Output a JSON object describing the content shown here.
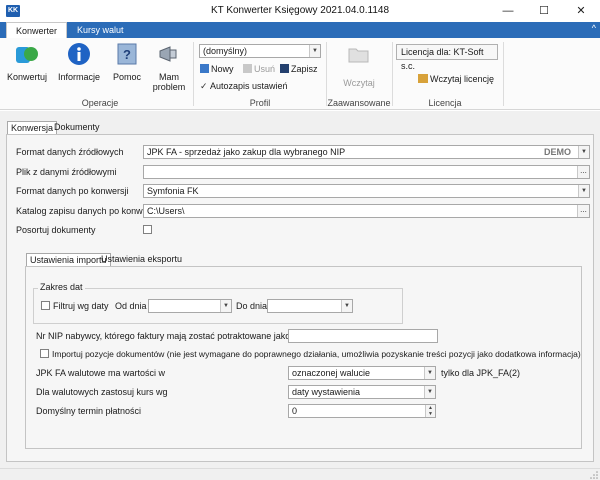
{
  "window": {
    "app_icon_label": "KK",
    "title": "KT Konwerter Księgowy 2021.04.0.1148",
    "minimize": "—",
    "maximize": "☐",
    "close": "✕"
  },
  "ribbon_tabs": [
    {
      "label": "Konwerter"
    },
    {
      "label": "Kursy walut"
    }
  ],
  "ribbon_collapse": "^",
  "ribbon": {
    "operacje": {
      "label": "Operacje",
      "buttons": [
        "Konwertuj",
        "Informacje",
        "Pomoc",
        "Mam problem"
      ]
    },
    "profil": {
      "label": "Profil",
      "selected": "(domyślny)",
      "new_label": "Nowy",
      "delete_label": "Usuń",
      "save_label": "Zapisz",
      "autosave_label": "Autozapis ustawień"
    },
    "zaawansowane": {
      "label": "Zaawansowane",
      "load_label": "Wczytaj"
    },
    "licencja": {
      "label": "Licencja",
      "license_text": "Licencja dla: KT-Soft s.c.",
      "load_license_label": "Wczytaj licencję"
    }
  },
  "main_tabs": [
    {
      "label": "Konwersja"
    },
    {
      "label": "Dokumenty"
    }
  ],
  "form": {
    "source_format_label": "Format danych źródłowych",
    "source_format_value": "JPK FA - sprzedaż jako zakup dla wybranego NIP",
    "demo_badge": "DEMO",
    "source_file_label": "Plik z danymi źródłowymi",
    "source_file_value": "",
    "target_format_label": "Format danych po konwersji",
    "target_format_value": "Symfonia FK",
    "output_dir_label": "Katalog zapisu danych po konwersji",
    "output_dir_value": "C:\\Users\\",
    "sort_label": "Posortuj dokumenty",
    "ellipsis": "..."
  },
  "inner_tabs": [
    {
      "label": "Ustawienia importu"
    },
    {
      "label": "Ustawienia eksportu"
    }
  ],
  "import_settings": {
    "date_range_title": "Zakres dat",
    "filter_by_date_label": "Filtruj wg daty",
    "from_label": "Od dnia",
    "to_label": "Do dnia",
    "nip_label": "Nr NIP nabywcy, którego faktury mają zostać potraktowane jako zakup",
    "nip_value": "",
    "import_positions_label": "Importuj pozycje dokumentów (nie jest wymagane do poprawnego działania, umożliwia pozyskanie treści pozycji jako dodatkowa informacja)",
    "currency_label": "JPK FA walutowe ma wartości w",
    "currency_value": "oznaczonej walucie",
    "currency_note": "tylko dla JPK_FA(2)",
    "rate_label": "Dla walutowych zastosuj kurs wg",
    "rate_value": "daty wystawienia",
    "payment_label": "Domyślny termin płatności",
    "payment_value": "0"
  },
  "colors": {
    "ribbon_blue": "#2b6cb8",
    "accent_green": "#3aa847",
    "info_blue": "#1f63c4"
  }
}
